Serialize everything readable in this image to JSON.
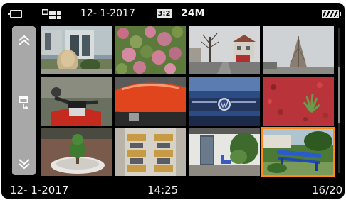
{
  "top_bar": {
    "date": "12-  1-2017",
    "aspect_ratio": "3:2",
    "image_size": "24M",
    "icons": [
      "display-mode-icon",
      "image-index-view-icon",
      "battery-icon"
    ]
  },
  "nav": {
    "icons": [
      "scroll-up-chevron-icon",
      "folder-jump-icon",
      "scroll-down-chevron-icon"
    ]
  },
  "grid": {
    "rows": 3,
    "columns": 4,
    "selected_index": 11,
    "thumbnails": [
      {
        "subject": "house-facade-with-pampas-grass"
      },
      {
        "subject": "pink-flowering-shrub"
      },
      {
        "subject": "street-with-bare-tree-and-houses"
      },
      {
        "subject": "bare-tree-against-grey-sky"
      },
      {
        "subject": "motorcycle-handlebars"
      },
      {
        "subject": "red-motorcycle-tank"
      },
      {
        "subject": "blue-volkswagen-front"
      },
      {
        "subject": "red-mulch-with-small-plant"
      },
      {
        "subject": "topiary-on-white-stone-bed"
      },
      {
        "subject": "building-with-balconies"
      },
      {
        "subject": "white-house-entrance"
      },
      {
        "subject": "blue-garden-bench"
      }
    ]
  },
  "bottom_bar": {
    "date": "12-  1-2017",
    "time": "14:25",
    "counter": "16/20"
  },
  "colors": {
    "selection_frame": "#ff8a1a",
    "background": "#000000",
    "text": "#f2f2f2"
  }
}
